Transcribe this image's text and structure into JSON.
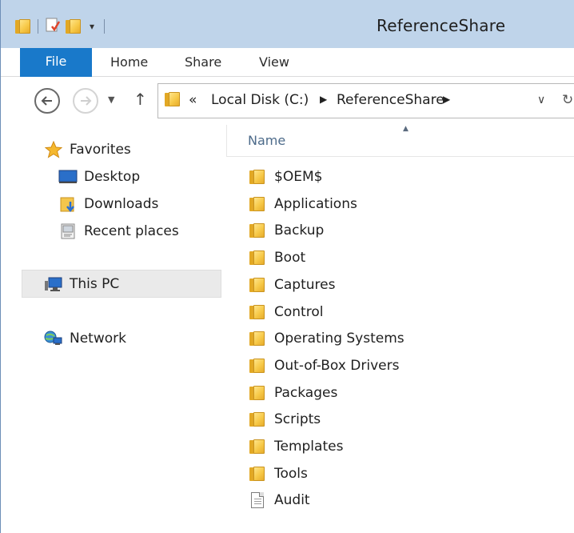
{
  "window": {
    "title": "ReferenceShare"
  },
  "ribbon": {
    "tabs": [
      {
        "label": "File"
      },
      {
        "label": "Home"
      },
      {
        "label": "Share"
      },
      {
        "label": "View"
      }
    ]
  },
  "address": {
    "prefix": "«",
    "segments": [
      "Local Disk (C:)",
      "ReferenceShare"
    ]
  },
  "navpane": {
    "favorites": {
      "label": "Favorites",
      "icon": "star-icon"
    },
    "favorite_items": [
      {
        "label": "Desktop",
        "icon": "desktop-icon"
      },
      {
        "label": "Downloads",
        "icon": "downloads-icon"
      },
      {
        "label": "Recent places",
        "icon": "recent-places-icon"
      }
    ],
    "this_pc": {
      "label": "This PC",
      "icon": "computer-icon"
    },
    "network": {
      "label": "Network",
      "icon": "network-icon"
    }
  },
  "content": {
    "columns": [
      {
        "label": "Name",
        "sorted": "ascending"
      }
    ],
    "items": [
      {
        "name": "$OEM$",
        "type": "folder"
      },
      {
        "name": "Applications",
        "type": "folder"
      },
      {
        "name": "Backup",
        "type": "folder"
      },
      {
        "name": "Boot",
        "type": "folder"
      },
      {
        "name": "Captures",
        "type": "folder"
      },
      {
        "name": "Control",
        "type": "folder"
      },
      {
        "name": "Operating Systems",
        "type": "folder"
      },
      {
        "name": "Out-of-Box Drivers",
        "type": "folder"
      },
      {
        "name": "Packages",
        "type": "folder"
      },
      {
        "name": "Scripts",
        "type": "folder"
      },
      {
        "name": "Templates",
        "type": "folder"
      },
      {
        "name": "Tools",
        "type": "folder"
      },
      {
        "name": "Audit",
        "type": "file"
      }
    ]
  },
  "colors": {
    "file_tab": "#1979ca",
    "titlebar": "#bfd4ea",
    "folder": "#f7c948",
    "selection": "#eaeaea"
  }
}
